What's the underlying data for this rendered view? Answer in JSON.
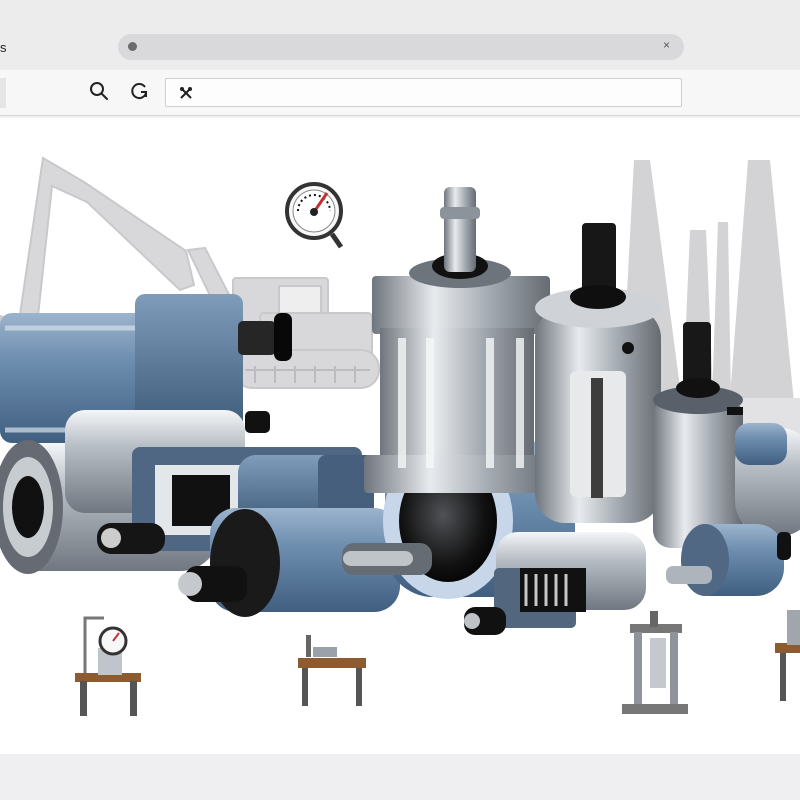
{
  "browser": {
    "tab_fragment": "s",
    "address_value": "",
    "url_value": ""
  },
  "icons": {
    "search": "search-icon",
    "refresh": "refresh-icon",
    "url": "tools-icon",
    "address_close": "close-icon"
  },
  "colors": {
    "cylinder_blue": "#6e8faf",
    "cylinder_blue_dark": "#4f6f8e",
    "steel": "#b7bcc2",
    "steel_dark": "#6f757c",
    "excavator_gray": "#d8d8da",
    "rod_black": "#141414"
  },
  "hero": {
    "items": [
      "excavator-silhouette",
      "pressure-gauge",
      "factory-silhouette",
      "blue-cylinder-large",
      "silver-cylinder-long",
      "cutaway-cylinder",
      "blue-cylinder-small",
      "silver-cylinder-rod",
      "compact-cylinder-front",
      "square-cylinder-tall",
      "round-cylinder-tall",
      "round-cylinder-small",
      "cutaway-mini-cylinder",
      "mini-cylinder-blue",
      "edge-cylinder",
      "gauge-test-bench",
      "work-table",
      "press-stand",
      "edge-bench"
    ]
  }
}
